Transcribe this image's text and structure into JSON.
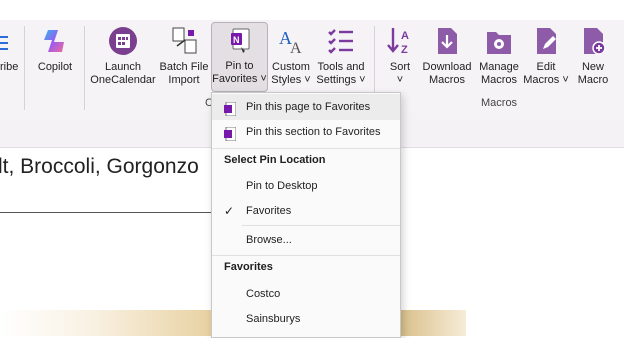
{
  "ribbon": {
    "left_partial": "ribe",
    "copilot": "Copilot",
    "launch_onecalendar": [
      "Launch",
      "OneCalendar"
    ],
    "batch_file_import": [
      "Batch File",
      "Import"
    ],
    "pin_to_favorites": [
      "Pin to",
      "Favorites ˅"
    ],
    "custom_styles": [
      "Custom",
      "Styles ˅"
    ],
    "tools_and_settings": [
      "Tools and",
      "Settings ˅"
    ],
    "sort": [
      "Sort",
      "˅"
    ],
    "download_macros": [
      "Download",
      "Macros"
    ],
    "manage_macros": [
      "Manage",
      "Macros"
    ],
    "edit_macros": [
      "Edit",
      "Macros ˅"
    ],
    "new_macro": [
      "New",
      "Macro"
    ],
    "group_partial": "C",
    "group_macros": "Macros"
  },
  "page": {
    "heading": "lt, Broccoli, Gorgonzo"
  },
  "pin_menu": {
    "pin_page": "Pin this page to Favorites",
    "pin_section": "Pin this section to Favorites",
    "select_location_header": "Select Pin Location",
    "pin_to_desktop": "Pin to Desktop",
    "favorites_option": "Favorites",
    "browse": "Browse...",
    "favorites_header": "Favorites",
    "items": [
      "Costco",
      "Sainsburys"
    ]
  },
  "colors": {
    "accent_purple": "#7b3a9e",
    "onenote_purple": "#7719aa",
    "ribbon_bg": "#f6f3f6"
  }
}
